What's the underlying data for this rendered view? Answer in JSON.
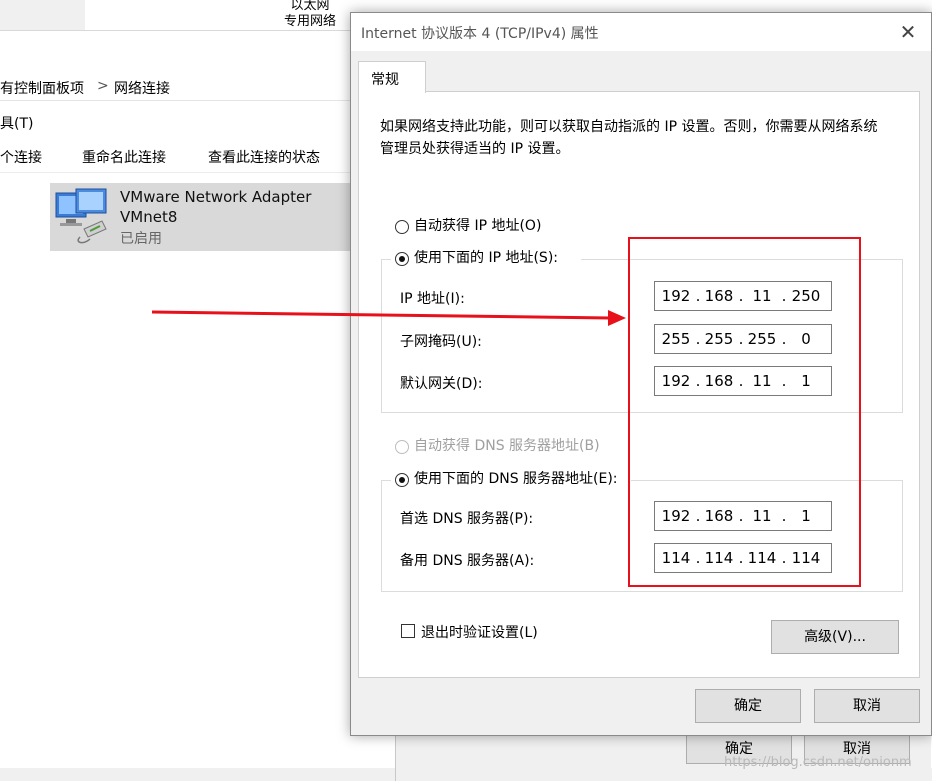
{
  "background": {
    "top_label_line1": "以太网",
    "top_label_line2": "专用网络",
    "breadcrumb": [
      "有控制面板项",
      ">",
      "网络连接"
    ],
    "menu_fragment": "具(T)",
    "toolbar": [
      "个连接",
      "重命名此连接",
      "查看此连接的状态"
    ],
    "adapter": {
      "name_line1": "VMware Network Adapter",
      "name_line2": "VMnet8",
      "status": "已启用",
      "icon": "network-adapter-icon"
    },
    "behind_buttons": [
      "确定",
      "取消"
    ],
    "watermark": "https://blog.csdn.net/onionm"
  },
  "dialog": {
    "title": "Internet 协议版本 4 (TCP/IPv4) 属性",
    "close_icon": "close-icon",
    "tab": "常规",
    "description": "如果网络支持此功能，则可以获取自动指派的 IP 设置。否则，你需要从网络系统管理员处获得适当的 IP 设置。",
    "ip_auto_label": "自动获得 IP 地址(O)",
    "ip_manual_label": "使用下面的 IP 地址(S):",
    "ip_mode": "manual",
    "ip_fields": [
      {
        "label": "IP 地址(I):",
        "octets": [
          "192",
          "168",
          "11",
          "250"
        ]
      },
      {
        "label": "子网掩码(U):",
        "octets": [
          "255",
          "255",
          "255",
          "0"
        ]
      },
      {
        "label": "默认网关(D):",
        "octets": [
          "192",
          "168",
          "11",
          "1"
        ]
      }
    ],
    "dns_auto_label": "自动获得 DNS 服务器地址(B)",
    "dns_manual_label": "使用下面的 DNS 服务器地址(E):",
    "dns_mode": "manual",
    "dns_fields": [
      {
        "label": "首选 DNS 服务器(P):",
        "octets": [
          "192",
          "168",
          "11",
          "1"
        ]
      },
      {
        "label": "备用 DNS 服务器(A):",
        "octets": [
          "114",
          "114",
          "114",
          "114"
        ]
      }
    ],
    "validate_label": "退出时验证设置(L)",
    "validate_checked": false,
    "advanced_label": "高级(V)...",
    "ok_label": "确定",
    "cancel_label": "取消"
  },
  "annotation": {
    "highlight_color": "#e8101a",
    "arrow_color": "#e8101a"
  }
}
